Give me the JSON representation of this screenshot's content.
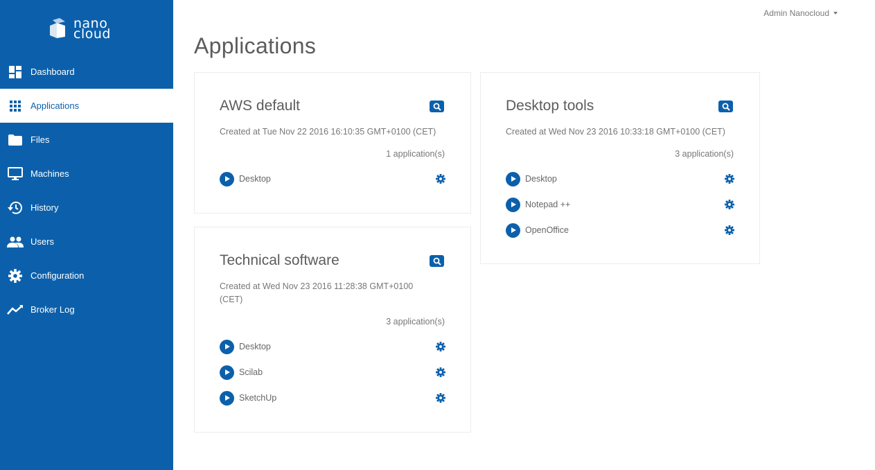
{
  "brand": {
    "line1": "nano",
    "line2": "cloud",
    "accent": "#0c60ab"
  },
  "sidebar": {
    "items": [
      {
        "label": "Dashboard",
        "icon": "dashboard-icon",
        "active": false
      },
      {
        "label": "Applications",
        "icon": "apps-grid-icon",
        "active": true
      },
      {
        "label": "Files",
        "icon": "folder-icon",
        "active": false
      },
      {
        "label": "Machines",
        "icon": "monitor-icon",
        "active": false
      },
      {
        "label": "History",
        "icon": "history-icon",
        "active": false
      },
      {
        "label": "Users",
        "icon": "users-icon",
        "active": false
      },
      {
        "label": "Configuration",
        "icon": "gear-icon",
        "active": false
      },
      {
        "label": "Broker Log",
        "icon": "line-chart-icon",
        "active": false
      }
    ]
  },
  "header": {
    "user": "Admin Nanocloud"
  },
  "page": {
    "title": "Applications"
  },
  "groups": [
    {
      "title": "AWS default",
      "created": "Created at Tue Nov 22 2016 16:10:35 GMT+0100 (CET)",
      "count": "1 application(s)",
      "apps": [
        "Desktop"
      ]
    },
    {
      "title": "Desktop tools",
      "created": "Created at Wed Nov 23 2016 10:33:18 GMT+0100 (CET)",
      "count": "3 application(s)",
      "apps": [
        "Desktop",
        "Notepad ++",
        "OpenOffice"
      ]
    },
    {
      "title": "Technical software",
      "created": "Created at Wed Nov 23 2016 11:28:38 GMT+0100 (CET)",
      "count": "3 application(s)",
      "apps": [
        "Desktop",
        "Scilab",
        "SketchUp"
      ]
    }
  ]
}
